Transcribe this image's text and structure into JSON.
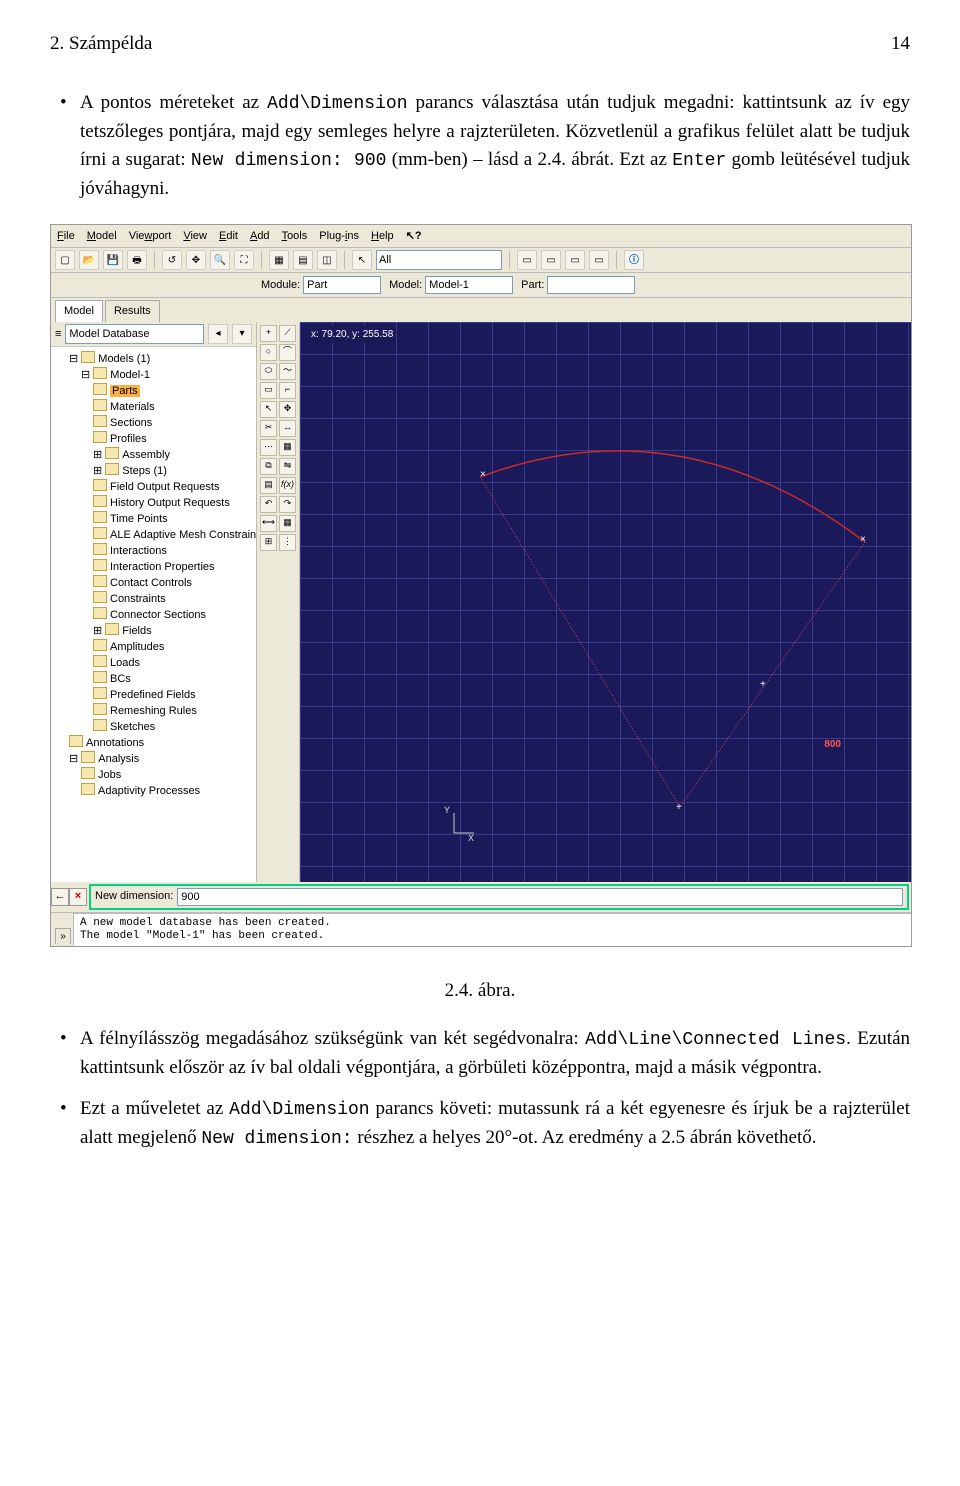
{
  "header": {
    "title": "2. Számpélda",
    "page": "14"
  },
  "para1": {
    "pre": "A pontos méreteket az ",
    "code1": "Add\\Dimension",
    "mid1": " parancs választása után tudjuk megadni: kattintsunk az ív egy tetszőleges pontjára, majd egy semleges helyre a rajzterületen. Közvetlenül a grafikus felület alatt be tudjuk írni a sugarat: ",
    "code2": "New dimension: 900",
    "mid2": " (mm-ben) – lásd a 2.4. ábrát. Ezt az ",
    "code3": "Enter",
    "mid3": " gomb leütésével tudjuk jóváhagyni."
  },
  "fig_caption": "2.4. ábra.",
  "para2": {
    "pre": "A félnyílásszög megadásához szükségünk van két segédvonalra: ",
    "code1": "Add\\Line\\Connected Lines",
    "post": ". Ezután kattintsunk először az ív bal oldali végpontjára, a görbületi középpontra, majd a másik végpontra."
  },
  "para3": {
    "pre": "Ezt a műveletet az ",
    "code1": "Add\\Dimension",
    "mid1": " parancs követi: mutassunk rá a két egyenesre és írjuk be a rajzterület alatt megjelenő ",
    "code2": "New dimension:",
    "mid2": " részhez a helyes 20°-ot. Az eredmény a 2.5 ábrán követhető."
  },
  "app": {
    "menus": [
      "File",
      "Model",
      "Viewport",
      "View",
      "Edit",
      "Add",
      "Tools",
      "Plug-ins",
      "Help"
    ],
    "toolbar_dropdown": "All",
    "context": {
      "module_label": "Module:",
      "module_value": "Part",
      "model_label": "Model:",
      "model_value": "Model-1",
      "part_label": "Part:",
      "part_value": ""
    },
    "tabs": [
      "Model",
      "Results"
    ],
    "tree_selector": "Model Database",
    "tree": [
      {
        "lvl": 0,
        "label": "Models (1)",
        "pre": "⊟ "
      },
      {
        "lvl": 1,
        "label": "Model-1",
        "pre": "⊟ "
      },
      {
        "lvl": 2,
        "label": "Parts",
        "selected": true
      },
      {
        "lvl": 2,
        "label": "Materials"
      },
      {
        "lvl": 2,
        "label": "Sections"
      },
      {
        "lvl": 2,
        "label": "Profiles"
      },
      {
        "lvl": 2,
        "label": "Assembly",
        "pre": "⊞ "
      },
      {
        "lvl": 2,
        "label": "Steps (1)",
        "pre": "⊞ "
      },
      {
        "lvl": 2,
        "label": "Field Output Requests"
      },
      {
        "lvl": 2,
        "label": "History Output Requests"
      },
      {
        "lvl": 2,
        "label": "Time Points"
      },
      {
        "lvl": 2,
        "label": "ALE Adaptive Mesh Constraints"
      },
      {
        "lvl": 2,
        "label": "Interactions"
      },
      {
        "lvl": 2,
        "label": "Interaction Properties"
      },
      {
        "lvl": 2,
        "label": "Contact Controls"
      },
      {
        "lvl": 2,
        "label": "Constraints"
      },
      {
        "lvl": 2,
        "label": "Connector Sections"
      },
      {
        "lvl": 2,
        "label": "Fields",
        "pre": "⊞ "
      },
      {
        "lvl": 2,
        "label": "Amplitudes"
      },
      {
        "lvl": 2,
        "label": "Loads"
      },
      {
        "lvl": 2,
        "label": "BCs"
      },
      {
        "lvl": 2,
        "label": "Predefined Fields"
      },
      {
        "lvl": 2,
        "label": "Remeshing Rules"
      },
      {
        "lvl": 2,
        "label": "Sketches"
      },
      {
        "lvl": 0,
        "label": "Annotations"
      },
      {
        "lvl": 0,
        "label": "Analysis",
        "pre": "⊟ "
      },
      {
        "lvl": 1,
        "label": "Jobs"
      },
      {
        "lvl": 1,
        "label": "Adaptivity Processes"
      }
    ],
    "coords": "x: 79.20, y: 255.58",
    "dim_label": "800",
    "axes": {
      "x": "X",
      "y": "Y"
    },
    "newdim_label": "New dimension:",
    "newdim_value": "900",
    "console_lines": "A new model database has been created.\nThe model \"Model-1\" has been created."
  }
}
